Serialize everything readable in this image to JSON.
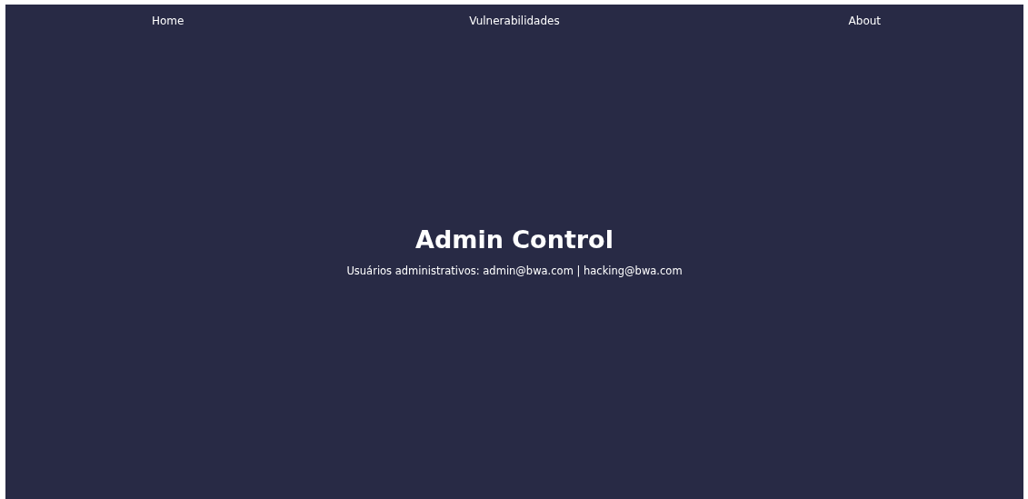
{
  "nav": {
    "items": [
      {
        "label": "Home"
      },
      {
        "label": "Vulnerabilidades"
      },
      {
        "label": "About"
      }
    ]
  },
  "main": {
    "title": "Admin Control",
    "subtitle": "Usuários administrativos: admin@bwa.com | hacking@bwa.com"
  }
}
